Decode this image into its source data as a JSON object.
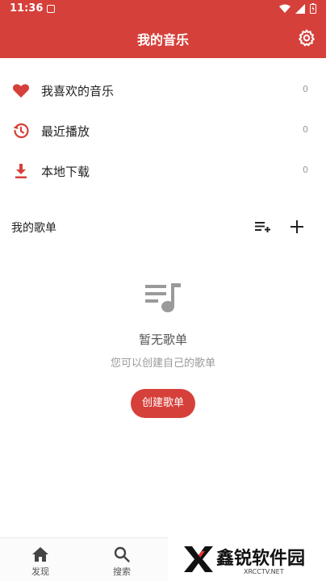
{
  "status_bar": {
    "time": "11:36"
  },
  "app_bar": {
    "title": "我的音乐"
  },
  "menu": [
    {
      "label": "我喜欢的音乐",
      "count": "0",
      "icon": "heart-icon"
    },
    {
      "label": "最近播放",
      "count": "0",
      "icon": "history-icon"
    },
    {
      "label": "本地下载",
      "count": "0",
      "icon": "download-icon"
    }
  ],
  "playlists": {
    "title": "我的歌单"
  },
  "empty_state": {
    "title": "暂无歌单",
    "subtitle": "您可以创建自己的歌单",
    "button": "创建歌单"
  },
  "bottom_nav": [
    {
      "label": "发现",
      "icon": "home-icon"
    },
    {
      "label": "搜索",
      "icon": "search-icon"
    }
  ],
  "watermark": {
    "text": "鑫锐软件园",
    "url": "XRCCTV.NET"
  },
  "colors": {
    "accent": "#d6403a"
  }
}
